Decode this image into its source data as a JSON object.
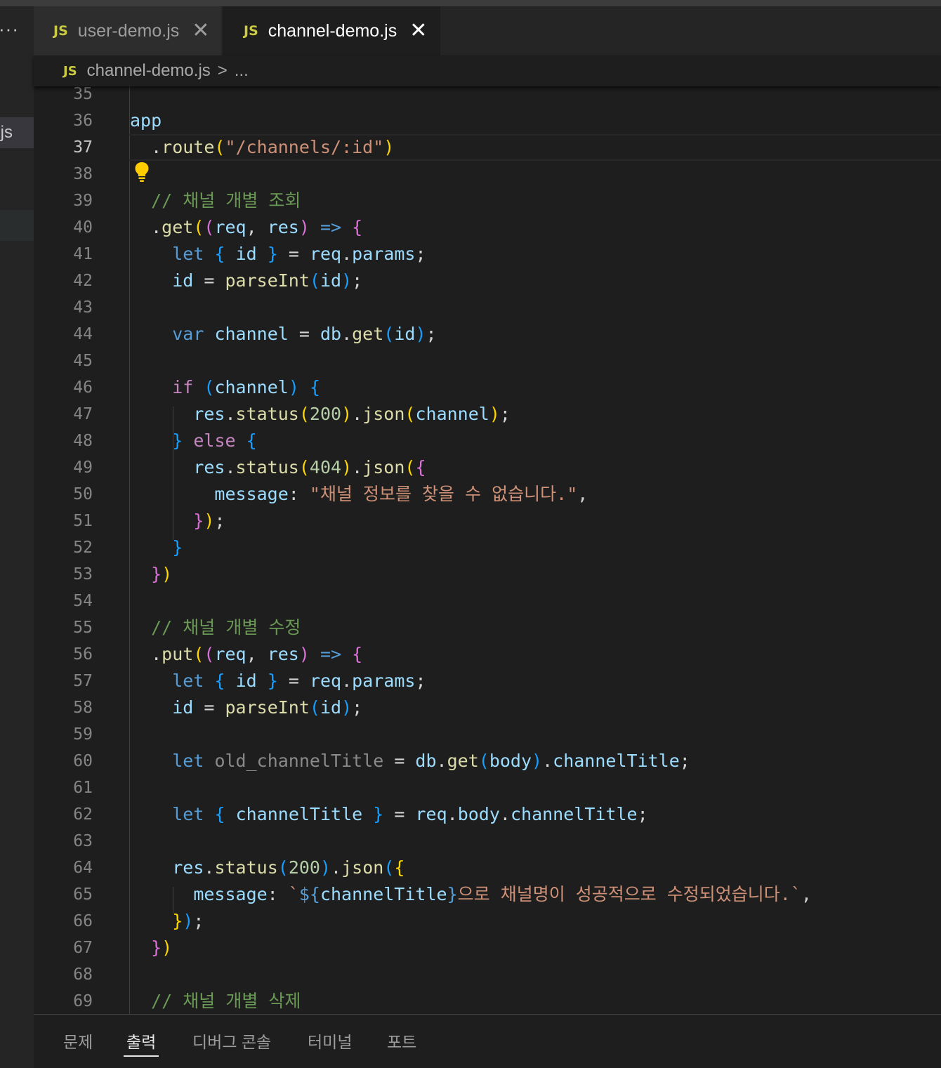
{
  "explorer": {
    "selected_file_fragment": ".js",
    "more_label": "···"
  },
  "tabs": [
    {
      "lang": "JS",
      "label": "user-demo.js",
      "close": "✕"
    },
    {
      "lang": "JS",
      "label": "channel-demo.js",
      "close": "✕"
    }
  ],
  "breadcrumb": {
    "lang": "JS",
    "file": "channel-demo.js",
    "sep": ">",
    "rest": "..."
  },
  "editor": {
    "line_numbers": [
      "35",
      "36",
      "37",
      "38",
      "39",
      "40",
      "41",
      "42",
      "43",
      "44",
      "45",
      "46",
      "47",
      "48",
      "49",
      "50",
      "51",
      "52",
      "53",
      "54",
      "55",
      "56",
      "57",
      "58",
      "59",
      "60",
      "61",
      "62",
      "63",
      "64",
      "65",
      "66",
      "67",
      "68",
      "69"
    ]
  },
  "panel": {
    "tabs": [
      "문제",
      "출력",
      "디버그 콘솔",
      "터미널",
      "포트"
    ]
  },
  "colors": {
    "keyword": "#569cd6",
    "control": "#c586c0",
    "function": "#dcdcaa",
    "variable": "#9cdcfe",
    "string": "#ce9178",
    "number": "#b5cea8",
    "comment": "#6a9955"
  }
}
